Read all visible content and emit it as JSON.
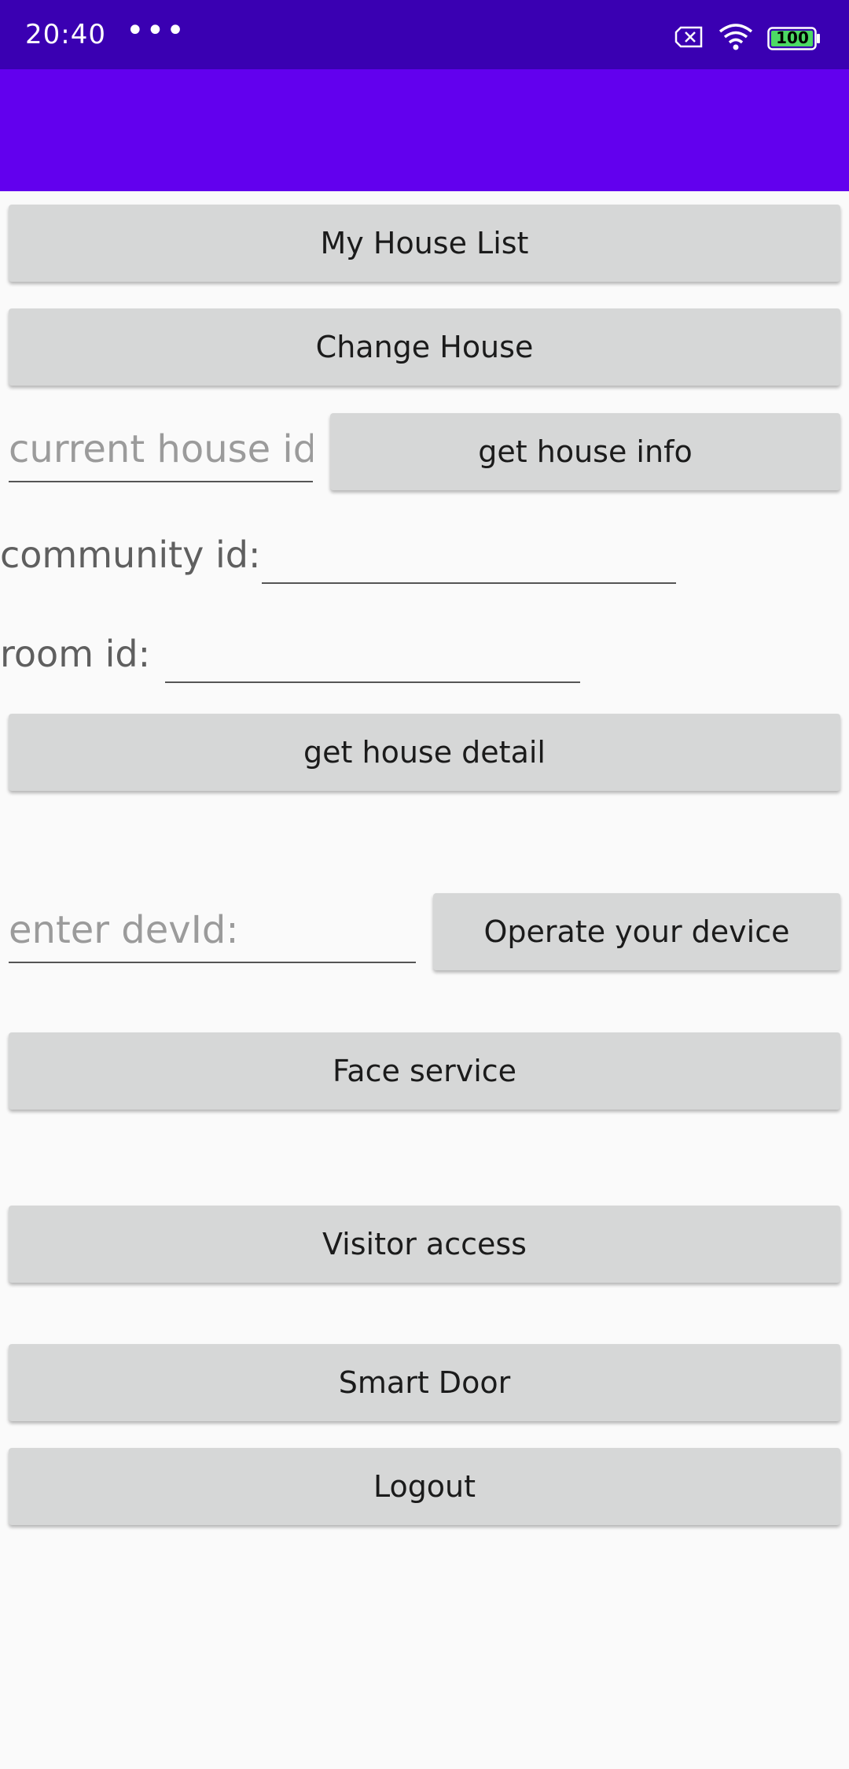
{
  "status_bar": {
    "time": "20:40",
    "more": "•••",
    "battery": "100",
    "icons": [
      "sim-card-x-icon",
      "wifi-icon",
      "battery-icon"
    ]
  },
  "colors": {
    "status_bar": "#3a00b2",
    "app_bar": "#6200ee",
    "button_bg": "#d6d7d7",
    "background": "#fafafa"
  },
  "buttons": {
    "my_house_list": "My House List",
    "change_house": "Change House",
    "get_house_info": "get house info",
    "get_house_detail": "get house detail",
    "operate_device": "Operate your device",
    "face_service": "Face service",
    "visitor_access": "Visitor access",
    "smart_door": "Smart Door",
    "logout": "Logout"
  },
  "fields": {
    "current_house_id_placeholder": "current house id",
    "community_id_label": "community id:",
    "community_id_value": "",
    "room_id_label": "room id:",
    "room_id_value": "",
    "dev_id_placeholder": "enter devId:"
  }
}
